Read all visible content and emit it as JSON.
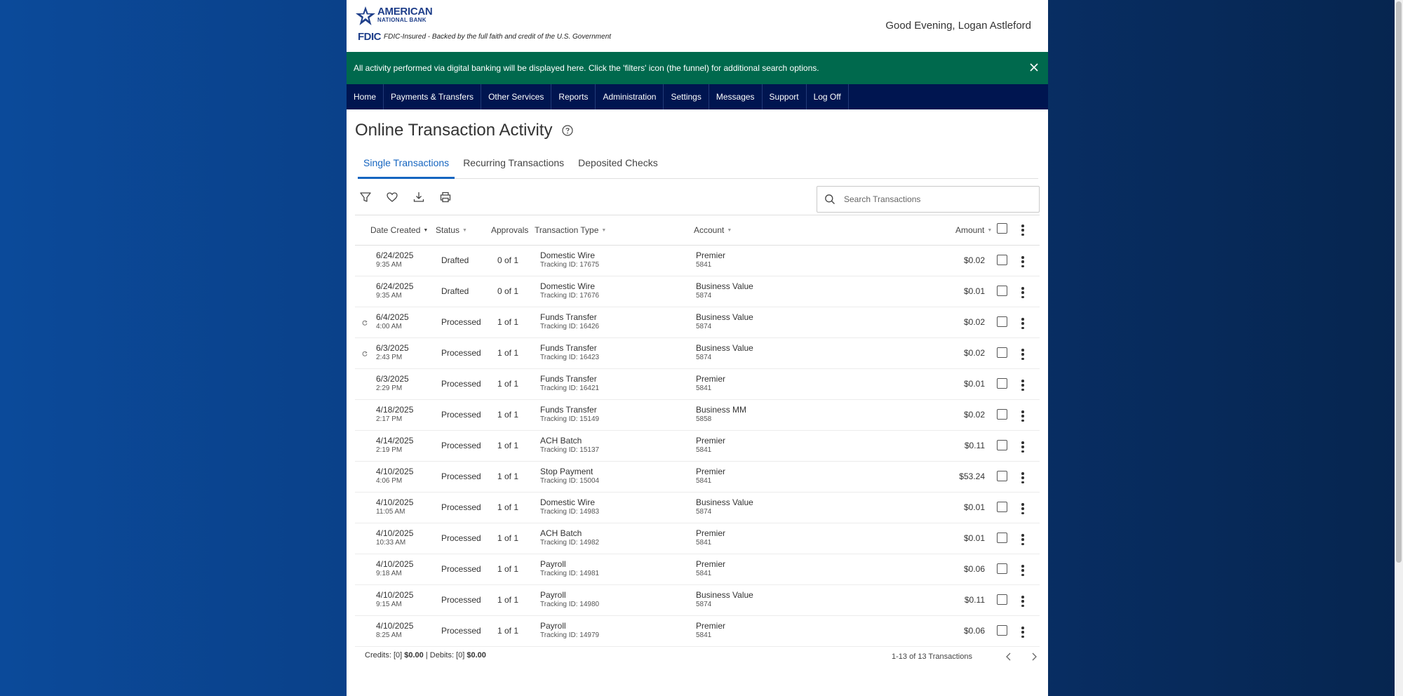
{
  "brand": {
    "name_line1": "AMERICAN",
    "name_line2": "NATIONAL BANK",
    "fdic_label": "FDIC",
    "fdic_note": "FDIC-Insured - Backed by the full faith and credit of the U.S. Government",
    "color": "#1f3f8a"
  },
  "header": {
    "greeting": "Good Evening, Logan Astleford"
  },
  "banner": {
    "text": "All activity performed via digital banking will be displayed here. Click the 'filters' icon (the funnel) for additional search options.",
    "color": "#00694d"
  },
  "nav": {
    "items": [
      "Home",
      "Payments & Transfers",
      "Other Services",
      "Reports",
      "Administration",
      "Settings",
      "Messages",
      "Support",
      "Log Off"
    ],
    "color": "#001550"
  },
  "page": {
    "title": "Online Transaction Activity"
  },
  "tabs": [
    {
      "label": "Single Transactions",
      "active": true
    },
    {
      "label": "Recurring Transactions",
      "active": false
    },
    {
      "label": "Deposited Checks",
      "active": false
    }
  ],
  "toolbar": {
    "icons": [
      "filter-icon",
      "heart-icon",
      "download-icon",
      "print-icon"
    ]
  },
  "search": {
    "placeholder": "Search Transactions",
    "value": ""
  },
  "table": {
    "columns": {
      "date": "Date Created",
      "status": "Status",
      "approvals": "Approvals",
      "type": "Transaction Type",
      "account": "Account",
      "amount": "Amount"
    },
    "rows": [
      {
        "date": "6/24/2025",
        "time": "9:35 AM",
        "status": "Drafted",
        "approvals": "0 of 1",
        "type": "Domestic Wire",
        "tracking": "Tracking ID: 17675",
        "account": "Premier",
        "acct_no": "5841",
        "amount": "$0.02",
        "recurring": false
      },
      {
        "date": "6/24/2025",
        "time": "9:35 AM",
        "status": "Drafted",
        "approvals": "0 of 1",
        "type": "Domestic Wire",
        "tracking": "Tracking ID: 17676",
        "account": "Business Value",
        "acct_no": "5874",
        "amount": "$0.01",
        "recurring": false
      },
      {
        "date": "6/4/2025",
        "time": "4:00 AM",
        "status": "Processed",
        "approvals": "1 of 1",
        "type": "Funds Transfer",
        "tracking": "Tracking ID: 16426",
        "account": "Business Value",
        "acct_no": "5874",
        "amount": "$0.02",
        "recurring": true
      },
      {
        "date": "6/3/2025",
        "time": "2:43 PM",
        "status": "Processed",
        "approvals": "1 of 1",
        "type": "Funds Transfer",
        "tracking": "Tracking ID: 16423",
        "account": "Business Value",
        "acct_no": "5874",
        "amount": "$0.02",
        "recurring": true
      },
      {
        "date": "6/3/2025",
        "time": "2:29 PM",
        "status": "Processed",
        "approvals": "1 of 1",
        "type": "Funds Transfer",
        "tracking": "Tracking ID: 16421",
        "account": "Premier",
        "acct_no": "5841",
        "amount": "$0.01",
        "recurring": false
      },
      {
        "date": "4/18/2025",
        "time": "2:17 PM",
        "status": "Processed",
        "approvals": "1 of 1",
        "type": "Funds Transfer",
        "tracking": "Tracking ID: 15149",
        "account": "Business MM",
        "acct_no": "5858",
        "amount": "$0.02",
        "recurring": false
      },
      {
        "date": "4/14/2025",
        "time": "2:19 PM",
        "status": "Processed",
        "approvals": "1 of 1",
        "type": "ACH Batch",
        "tracking": "Tracking ID: 15137",
        "account": "Premier",
        "acct_no": "5841",
        "amount": "$0.11",
        "recurring": false
      },
      {
        "date": "4/10/2025",
        "time": "4:06 PM",
        "status": "Processed",
        "approvals": "1 of 1",
        "type": "Stop Payment",
        "tracking": "Tracking ID: 15004",
        "account": "Premier",
        "acct_no": "5841",
        "amount": "$53.24",
        "recurring": false
      },
      {
        "date": "4/10/2025",
        "time": "11:05 AM",
        "status": "Processed",
        "approvals": "1 of 1",
        "type": "Domestic Wire",
        "tracking": "Tracking ID: 14983",
        "account": "Business Value",
        "acct_no": "5874",
        "amount": "$0.01",
        "recurring": false
      },
      {
        "date": "4/10/2025",
        "time": "10:33 AM",
        "status": "Processed",
        "approvals": "1 of 1",
        "type": "ACH Batch",
        "tracking": "Tracking ID: 14982",
        "account": "Premier",
        "acct_no": "5841",
        "amount": "$0.01",
        "recurring": false
      },
      {
        "date": "4/10/2025",
        "time": "9:18 AM",
        "status": "Processed",
        "approvals": "1 of 1",
        "type": "Payroll",
        "tracking": "Tracking ID: 14981",
        "account": "Premier",
        "acct_no": "5841",
        "amount": "$0.06",
        "recurring": false
      },
      {
        "date": "4/10/2025",
        "time": "9:15 AM",
        "status": "Processed",
        "approvals": "1 of 1",
        "type": "Payroll",
        "tracking": "Tracking ID: 14980",
        "account": "Business Value",
        "acct_no": "5874",
        "amount": "$0.11",
        "recurring": false
      },
      {
        "date": "4/10/2025",
        "time": "8:25 AM",
        "status": "Processed",
        "approvals": "1 of 1",
        "type": "Payroll",
        "tracking": "Tracking ID: 14979",
        "account": "Premier",
        "acct_no": "5841",
        "amount": "$0.06",
        "recurring": false
      }
    ]
  },
  "footer": {
    "credits_label": "Credits: [0]",
    "credits_amount": "$0.00",
    "separator": "|",
    "debits_label": "Debits: [0]",
    "debits_amount": "$0.00",
    "pager_text": "1-13 of 13 Transactions"
  }
}
